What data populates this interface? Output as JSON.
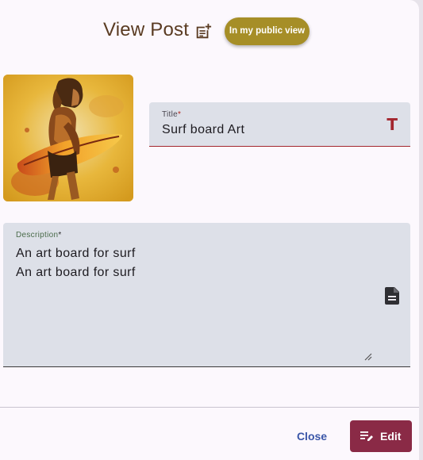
{
  "dialog": {
    "title": "View Post",
    "title_icon": "post-add-icon",
    "visibility_chip": "In my public view"
  },
  "post": {
    "image_alt": "surfer-artwork-thumbnail",
    "title_field": {
      "label": "Title",
      "required_mark": "*",
      "value": "Surf board Art",
      "icon": "text-t-icon",
      "icon_glyph": "T"
    },
    "description_field": {
      "label": "Description",
      "required_mark": "*",
      "value": "An art board for surf\nAn art board for surf",
      "icon": "document-icon"
    }
  },
  "actions": {
    "close_label": "Close",
    "edit_label": "Edit",
    "edit_icon": "edit-note-icon"
  },
  "colors": {
    "chip": "#a68e27",
    "accent_red": "#a3262e",
    "edit_button": "#8a2a46",
    "close_text": "#3a56a8",
    "title_text": "#5a3b22"
  }
}
